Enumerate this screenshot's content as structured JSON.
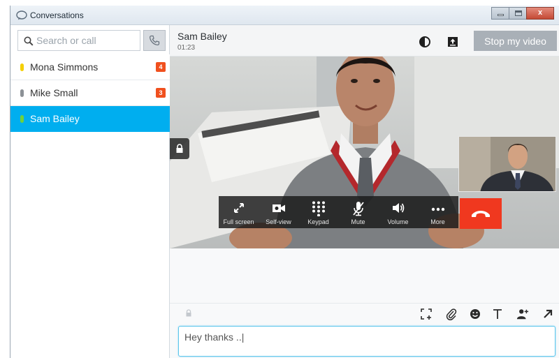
{
  "window": {
    "title": "Conversations",
    "controls": {
      "minimize": "",
      "maximize": "",
      "close": "x"
    }
  },
  "sidebar": {
    "search_placeholder": "Search or call",
    "call_icon": "phone-icon",
    "conversations": [
      {
        "name": "Mona Simmons",
        "presence_color": "#f5d000",
        "badge": "4",
        "badge_color": "#f0501e",
        "active": false
      },
      {
        "name": "Mike Small",
        "presence_color": "#8c9196",
        "badge": "3",
        "badge_color": "#f0501e",
        "active": false
      },
      {
        "name": "Sam Bailey",
        "presence_color": "#6fd23c",
        "badge": "",
        "active": true
      }
    ]
  },
  "call": {
    "contact_name": "Sam Bailey",
    "duration": "01:23",
    "header_icons": [
      "contrast-icon",
      "share-screen-icon"
    ],
    "stop_video_label": "Stop my video",
    "controls": [
      {
        "label": "Full screen",
        "icon": "fullscreen-icon"
      },
      {
        "label": "Self-view",
        "icon": "camera-icon"
      },
      {
        "label": "Keypad",
        "icon": "keypad-icon"
      },
      {
        "label": "Mute",
        "icon": "microphone-muted-icon"
      },
      {
        "label": "Volume",
        "icon": "speaker-icon"
      },
      {
        "label": "More",
        "icon": "more-dots-icon"
      }
    ],
    "end_call_icon": "hang-up-icon",
    "end_call_color": "#f0381f"
  },
  "composer": {
    "toolbar_icons": [
      "screenshot-icon",
      "paperclip-icon",
      "emoji-icon",
      "text-format-icon",
      "add-person-icon",
      "send-icon"
    ],
    "message_value": "Hey thanks ..|"
  },
  "colors": {
    "accent": "#00aeef",
    "stop_video_bg": "#a9b0b7"
  }
}
